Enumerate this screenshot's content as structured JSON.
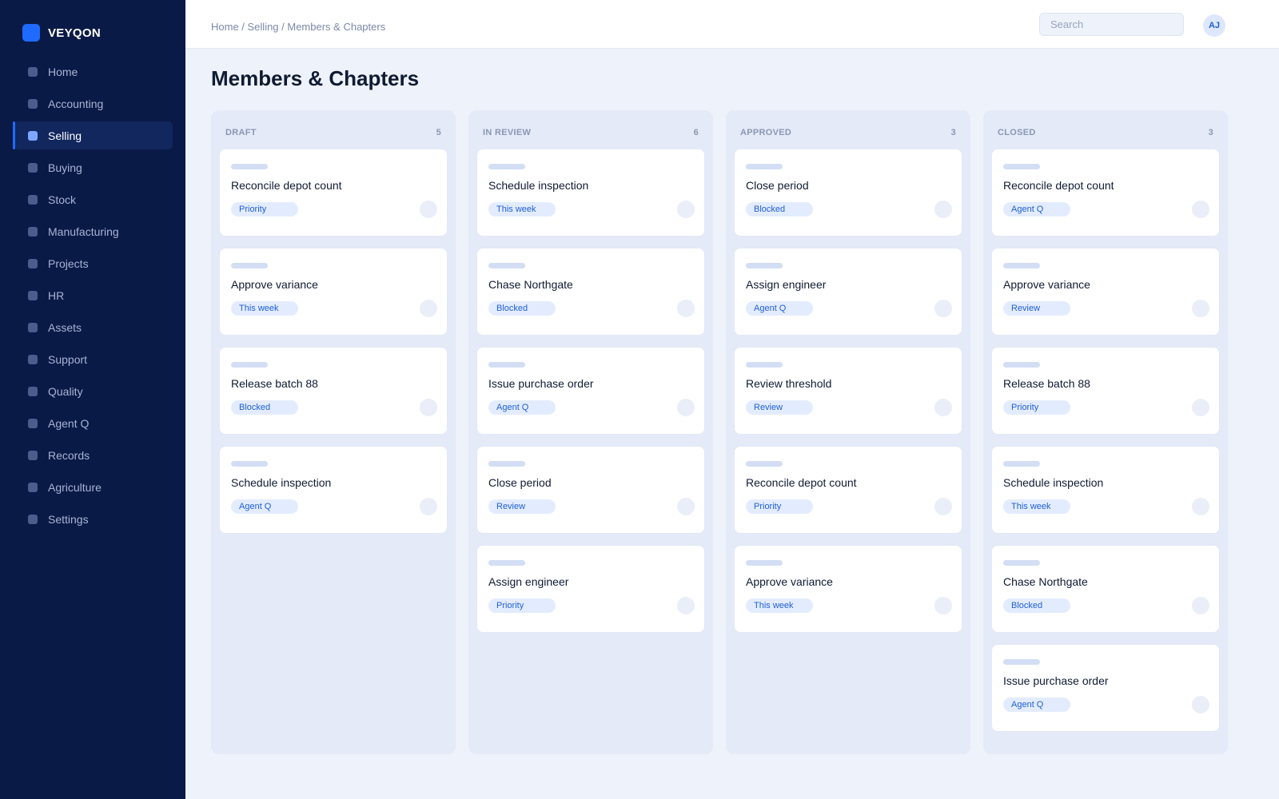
{
  "brand": {
    "name": "VEYQON"
  },
  "sidebar": {
    "items": [
      {
        "label": "Home",
        "active": false
      },
      {
        "label": "Accounting",
        "active": false
      },
      {
        "label": "Selling",
        "active": true
      },
      {
        "label": "Buying",
        "active": false
      },
      {
        "label": "Stock",
        "active": false
      },
      {
        "label": "Manufacturing",
        "active": false
      },
      {
        "label": "Projects",
        "active": false
      },
      {
        "label": "HR",
        "active": false
      },
      {
        "label": "Assets",
        "active": false
      },
      {
        "label": "Support",
        "active": false
      },
      {
        "label": "Quality",
        "active": false
      },
      {
        "label": "Agent Q",
        "active": false
      },
      {
        "label": "Records",
        "active": false
      },
      {
        "label": "Agriculture",
        "active": false
      },
      {
        "label": "Settings",
        "active": false
      }
    ]
  },
  "header": {
    "breadcrumb": "Home / Selling / Members & Chapters",
    "search_placeholder": "Search",
    "avatar_initials": "AJ"
  },
  "page": {
    "title": "Members & Chapters"
  },
  "board": {
    "columns": [
      {
        "title": "DRAFT",
        "count": "5",
        "cards": [
          {
            "title": "Reconcile depot count",
            "tag": "Priority"
          },
          {
            "title": "Approve variance",
            "tag": "This week"
          },
          {
            "title": "Release batch 88",
            "tag": "Blocked"
          },
          {
            "title": "Schedule inspection",
            "tag": "Agent Q"
          }
        ]
      },
      {
        "title": "IN REVIEW",
        "count": "6",
        "cards": [
          {
            "title": "Schedule inspection",
            "tag": "This week"
          },
          {
            "title": "Chase Northgate",
            "tag": "Blocked"
          },
          {
            "title": "Issue purchase order",
            "tag": "Agent Q"
          },
          {
            "title": "Close period",
            "tag": "Review"
          },
          {
            "title": "Assign engineer",
            "tag": "Priority"
          }
        ]
      },
      {
        "title": "APPROVED",
        "count": "3",
        "cards": [
          {
            "title": "Close period",
            "tag": "Blocked"
          },
          {
            "title": "Assign engineer",
            "tag": "Agent Q"
          },
          {
            "title": "Review threshold",
            "tag": "Review"
          },
          {
            "title": "Reconcile depot count",
            "tag": "Priority"
          },
          {
            "title": "Approve variance",
            "tag": "This week"
          }
        ]
      },
      {
        "title": "CLOSED",
        "count": "3",
        "cards": [
          {
            "title": "Reconcile depot count",
            "tag": "Agent Q"
          },
          {
            "title": "Approve variance",
            "tag": "Review"
          },
          {
            "title": "Release batch 88",
            "tag": "Priority"
          },
          {
            "title": "Schedule inspection",
            "tag": "This week"
          },
          {
            "title": "Chase Northgate",
            "tag": "Blocked"
          },
          {
            "title": "Issue purchase order",
            "tag": "Agent Q"
          }
        ]
      }
    ]
  }
}
